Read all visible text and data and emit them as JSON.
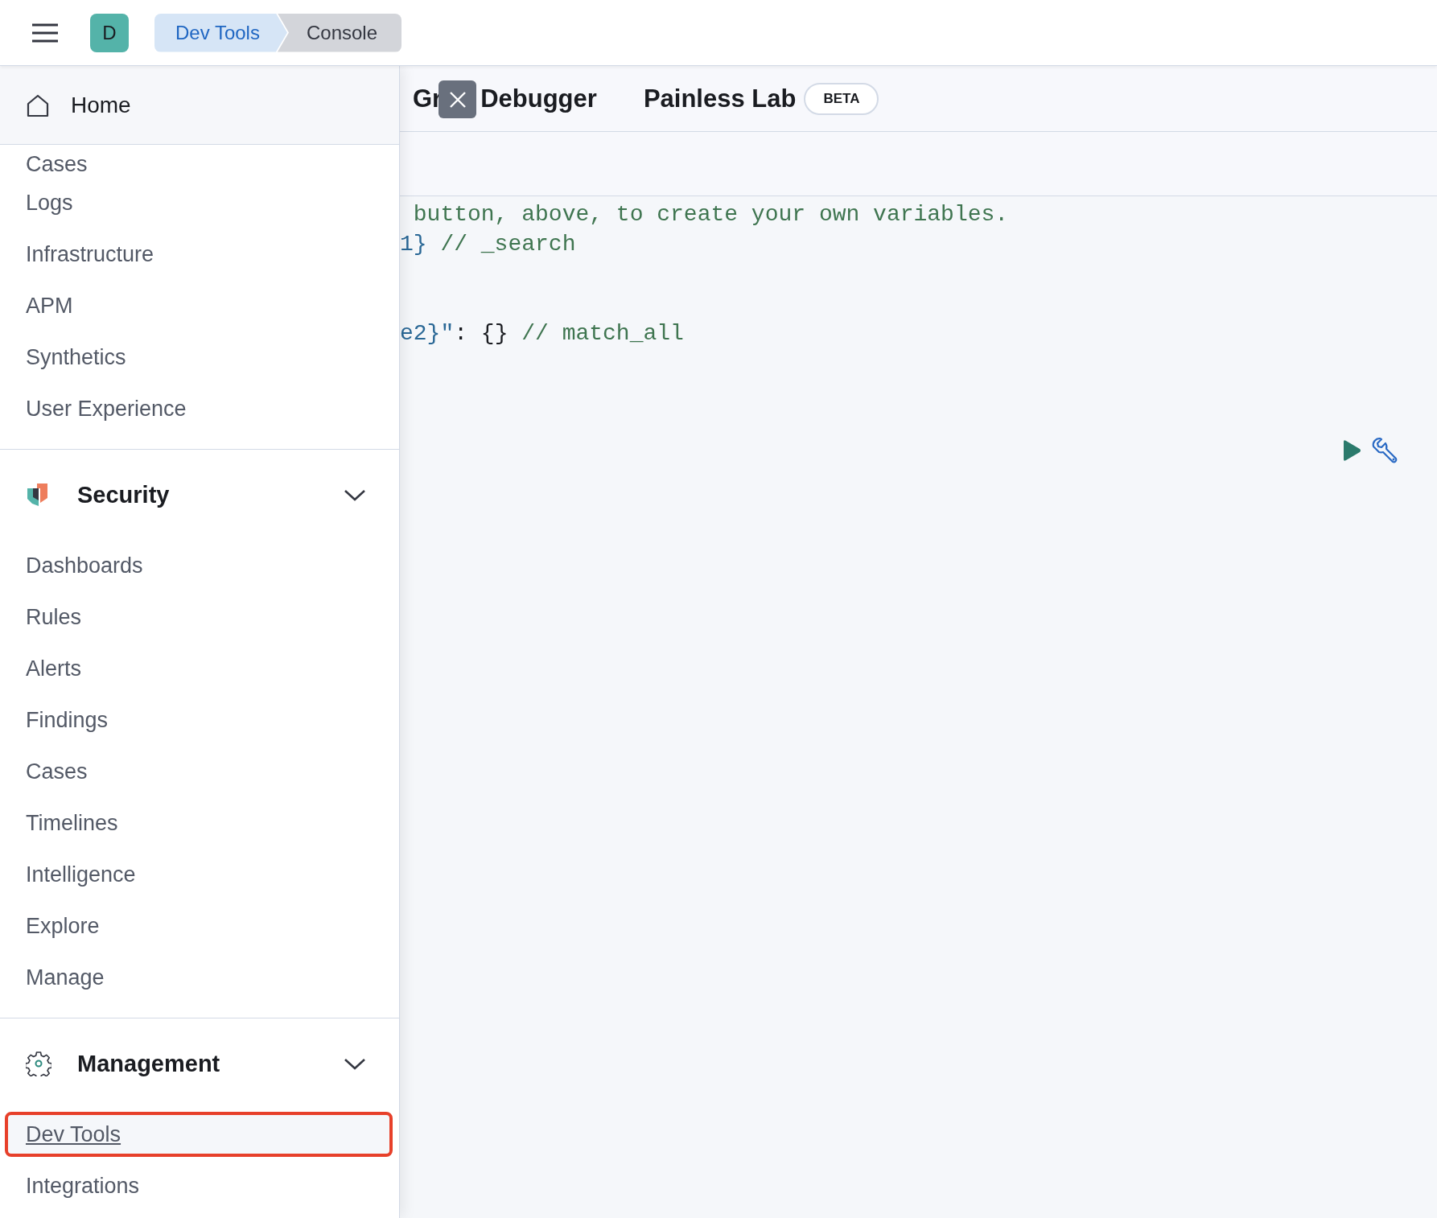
{
  "header": {
    "avatar": "D",
    "breadcrumbs": [
      {
        "label": "Dev Tools",
        "selected": false
      },
      {
        "label": "Console",
        "selected": true
      }
    ]
  },
  "sidebar": {
    "home": "Home",
    "top_items": [
      {
        "label": "Cases",
        "selected": false
      },
      {
        "label": "Logs",
        "selected": false
      },
      {
        "label": "Infrastructure",
        "selected": false
      },
      {
        "label": "APM",
        "selected": false
      },
      {
        "label": "Synthetics",
        "selected": false
      },
      {
        "label": "User Experience",
        "selected": false
      }
    ],
    "sections": [
      {
        "kind": "security",
        "title": "Security",
        "expanded": true,
        "items": [
          {
            "label": "Dashboards",
            "selected": false
          },
          {
            "label": "Rules",
            "selected": false
          },
          {
            "label": "Alerts",
            "selected": false
          },
          {
            "label": "Findings",
            "selected": false
          },
          {
            "label": "Cases",
            "selected": false
          },
          {
            "label": "Timelines",
            "selected": false
          },
          {
            "label": "Intelligence",
            "selected": false
          },
          {
            "label": "Explore",
            "selected": false
          },
          {
            "label": "Manage",
            "selected": false
          }
        ]
      },
      {
        "kind": "management",
        "title": "Management",
        "expanded": true,
        "items": [
          {
            "label": "Dev Tools",
            "selected": true
          },
          {
            "label": "Integrations",
            "selected": false
          }
        ]
      }
    ]
  },
  "tabs": [
    {
      "label_parts": [
        "Gr",
        "Debugger"
      ],
      "selected": false
    },
    {
      "label_parts": [
        "Painless Lab"
      ],
      "badge": "BETA",
      "selected": false
    }
  ],
  "editor": {
    "lines": [
      {
        "kind": "code",
        "tokens": [
          {
            "kind": "comment",
            "text": " button, above, to create your own variables."
          }
        ]
      },
      {
        "kind": "code",
        "tokens": [
          {
            "kind": "variable",
            "text": "1}"
          },
          {
            "kind": "comment",
            "text": " // _search"
          }
        ]
      },
      {
        "kind": "blank"
      },
      {
        "kind": "blank"
      },
      {
        "kind": "code",
        "tokens": [
          {
            "kind": "variable",
            "text": "e2}\""
          },
          {
            "kind": "punct",
            "text": ": {}"
          },
          {
            "kind": "comment",
            "text": " // match_all"
          }
        ]
      }
    ]
  }
}
